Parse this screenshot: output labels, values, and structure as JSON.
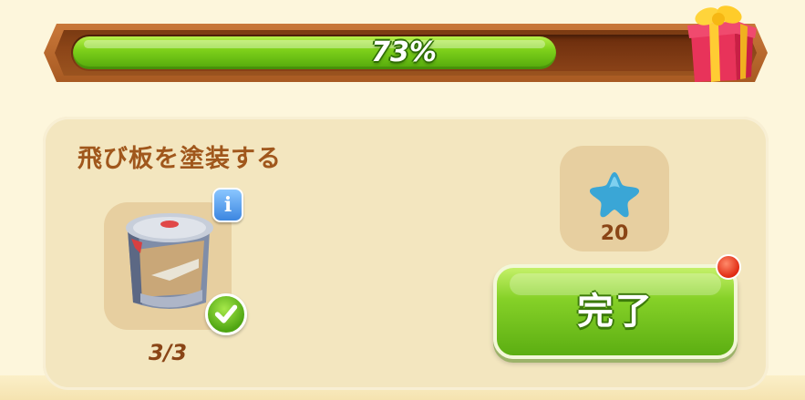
{
  "progress": {
    "value": 0.73,
    "label": "73%",
    "fill_color": "#7fd11b",
    "reward_icon": "gift-box-icon"
  },
  "task": {
    "title": "飛び板を塗装する",
    "item": {
      "icon": "paint-can-icon",
      "count_label": "3/3",
      "info_label": "i",
      "completed_icon": "checkmark-icon"
    },
    "reward": {
      "icon": "blue-star-icon",
      "amount": "20"
    },
    "complete_button": {
      "label": "完了",
      "notification_icon": "red-notification-dot"
    }
  }
}
